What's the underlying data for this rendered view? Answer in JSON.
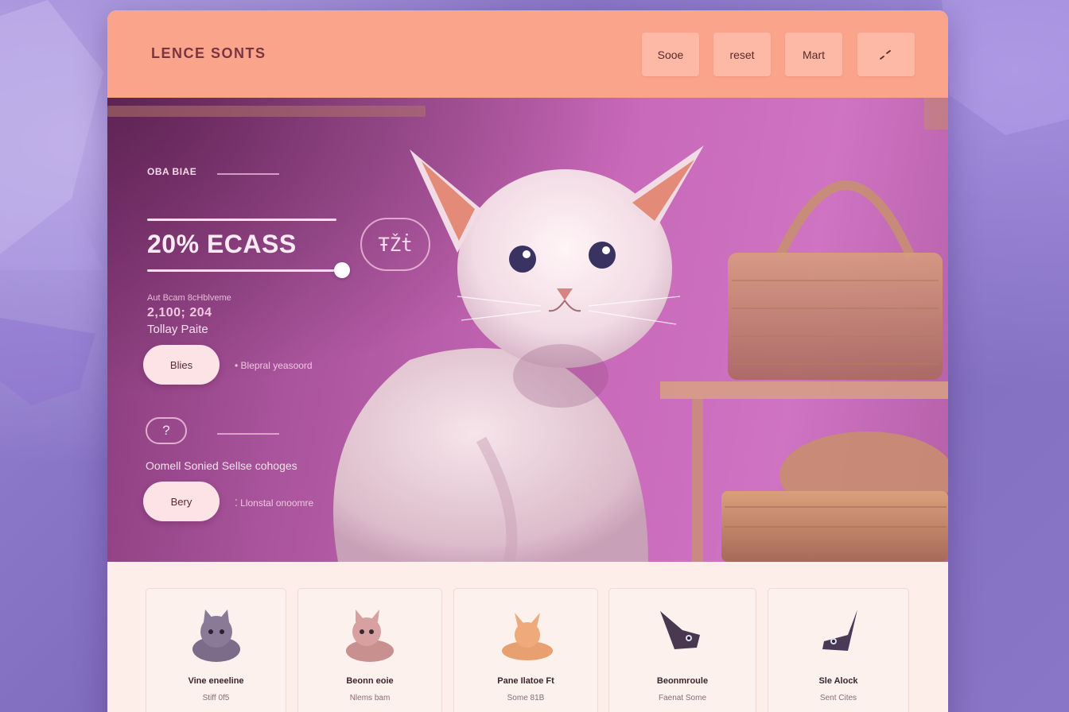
{
  "app": {
    "brand": "LENCE SONTS"
  },
  "header": {
    "nav": [
      {
        "label": "Sooe"
      },
      {
        "label": "reset"
      },
      {
        "label": "Mart"
      },
      {
        "label": "⸝⸝"
      }
    ]
  },
  "hero": {
    "kicker": "OBA BIAE",
    "title": "20% ECASS",
    "badge": "ŦŽṫ",
    "meta_small": "Aut Bcam 8cHblveme",
    "meta_value": "2,100; 204",
    "section_label": "Tollay Paite",
    "primary_button": "Blies",
    "primary_hint": "• Blepral yeasoord",
    "question_symbol": "?",
    "section_label_2": "Oomell Sonied Sellse cohoges",
    "secondary_button": "Bery",
    "secondary_hint": "⁚ Llonstal onoomre"
  },
  "products": [
    {
      "name": "Vine eneeline",
      "price": "Stiff 0f5",
      "color": "#7d6b8a",
      "icon": "gray-kitten"
    },
    {
      "name": "Beonn eoie",
      "price": "Nlems bam",
      "color": "#c99090",
      "icon": "tabby-kitten"
    },
    {
      "name": "Pane Ilatoe Ft",
      "price": "Some 81B",
      "color": "#e8a070",
      "icon": "orange-kitten"
    },
    {
      "name": "Beonmroule",
      "price": "Faenat Some",
      "color": "#4a3850",
      "icon": "dark-kitten"
    },
    {
      "name": "Sle Alock",
      "price": "Sent Cites",
      "color": "#4a3a58",
      "icon": "dark-kitten"
    }
  ],
  "colors": {
    "header": "#fba48c",
    "hero_accent": "#c868b8",
    "background": "#8d78c8"
  }
}
